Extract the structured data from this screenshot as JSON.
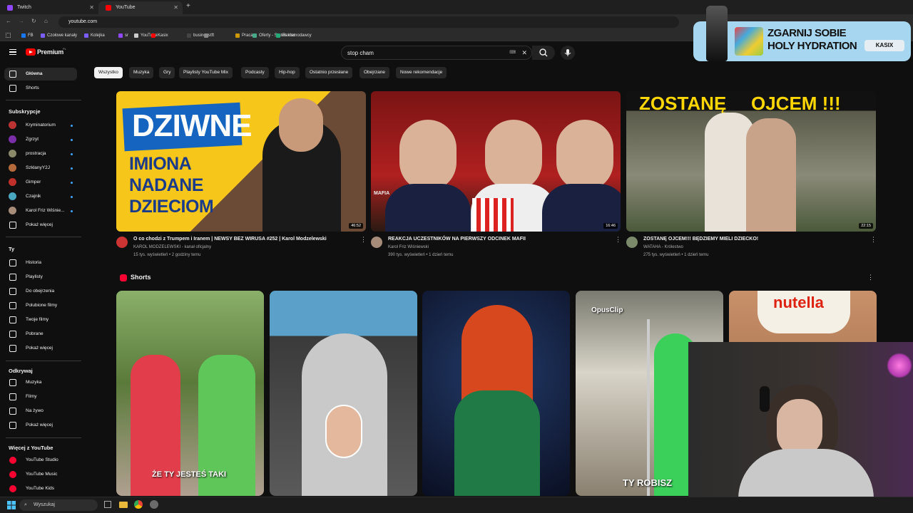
{
  "browser": {
    "tabs": [
      {
        "label": "Twitch",
        "color": "#9146ff"
      },
      {
        "label": "YouTube",
        "color": "#ff0000"
      }
    ],
    "new_tab": "+",
    "url": "youtube.com",
    "bookmarks": [
      "FB",
      "Czołowe kanały",
      "Kolejka",
      "sr",
      "YouTube",
      "Kasix",
      "business",
      "tft",
      "Praca",
      "Oferty - Status.xlsx",
      "Reklamodawcy"
    ]
  },
  "header": {
    "logo": "Premium",
    "logo_region": "PL",
    "search_value": "stop cham",
    "search_clear": "✕"
  },
  "chips": [
    "Wszystko",
    "Muzyka",
    "Gry",
    "Playlisty YouTube Mix",
    "Podcasty",
    "Hip-hop",
    "Ostatnio przesłane",
    "Obejrzane",
    "Nowe rekomendacje"
  ],
  "sidebar": {
    "main": [
      {
        "label": "Główna",
        "icon": "home-icon"
      },
      {
        "label": "Shorts",
        "icon": "shorts-icon"
      }
    ],
    "subs_title": "Subskrypcje",
    "subs": [
      {
        "label": "Kryminatorium",
        "color": "#b33"
      },
      {
        "label": "Zgrzyt",
        "color": "#7a2fa8"
      },
      {
        "label": "prostracja",
        "color": "#8a8a6a"
      },
      {
        "label": "SzklanyY2J",
        "color": "#b46a3a"
      },
      {
        "label": "Gimper",
        "color": "#c0302a"
      },
      {
        "label": "Czajnik",
        "color": "#4aa7c0"
      },
      {
        "label": "Karol Friz Wiśnie...",
        "color": "#a78c7a"
      }
    ],
    "subs_more": "Pokaż więcej",
    "you_title": "Ty",
    "you": [
      {
        "label": "Historia",
        "icon": "history-icon"
      },
      {
        "label": "Playlisty",
        "icon": "playlist-icon"
      },
      {
        "label": "Do obejrzenia",
        "icon": "clock-icon"
      },
      {
        "label": "Polubione filmy",
        "icon": "thumb-up-icon"
      },
      {
        "label": "Twoje filmy",
        "icon": "video-icon"
      },
      {
        "label": "Pobrane",
        "icon": "download-icon"
      },
      {
        "label": "Pokaż więcej",
        "icon": "chevron-down-icon"
      }
    ],
    "explore_title": "Odkrywaj",
    "explore": [
      {
        "label": "Muzyka",
        "icon": "music-icon"
      },
      {
        "label": "Filmy",
        "icon": "film-icon"
      },
      {
        "label": "Na żywo",
        "icon": "live-icon"
      },
      {
        "label": "Pokaż więcej",
        "icon": "chevron-down-icon"
      }
    ],
    "more_title": "Więcej z YouTube",
    "more": [
      {
        "label": "YouTube Studio"
      },
      {
        "label": "YouTube Music"
      },
      {
        "label": "YouTube Kids"
      }
    ]
  },
  "videos": [
    {
      "thumb_text": [
        "DZIWNE",
        "IMIONA",
        "NADANE",
        "DZIECIOM"
      ],
      "duration": "46:52",
      "title": "O co chodzi z Trumpem i Iranem | NEWSY BEZ WIRUSA #252 | Karol Modzelewski",
      "channel": "KAROL MODZELEWSKI - kanał oficjalny",
      "meta": "15 tys. wyświetleń • 2 godziny temu"
    },
    {
      "thumb_text": [
        "MAFIA"
      ],
      "duration": "16:46",
      "title": "REAKCJA UCZESTNIKÓW NA PIERWSZY ODCINEK MAFII",
      "channel": "Karol Friz Wiśniewski",
      "meta": "390 tys. wyświetleń • 1 dzień temu"
    },
    {
      "thumb_text": [
        "ZOSTANĘ",
        "OJCEM !!!"
      ],
      "duration": "22:15",
      "title": "ZOSTANĘ OJCEM!!! BĘDZIEMY MIELI DZIECKO!",
      "channel": "WATAHA - Królestwo",
      "meta": "275 tys. wyświetleń • 1 dzień temu"
    }
  ],
  "shorts": {
    "title": "Shorts",
    "items": [
      {
        "caption": "ŻE TY JESTEŚ TAKI"
      },
      {
        "caption": ""
      },
      {
        "caption": ""
      },
      {
        "caption": "TY ROBISZ",
        "badge": "OpusClip"
      },
      {
        "caption": "",
        "brand": "nutella"
      }
    ]
  },
  "ad": {
    "line1": "ZGARNIJ SOBIE",
    "line2": "HOLY HYDRATION",
    "tag": "KASIX"
  },
  "taskbar": {
    "search": "Wyszukaj"
  }
}
